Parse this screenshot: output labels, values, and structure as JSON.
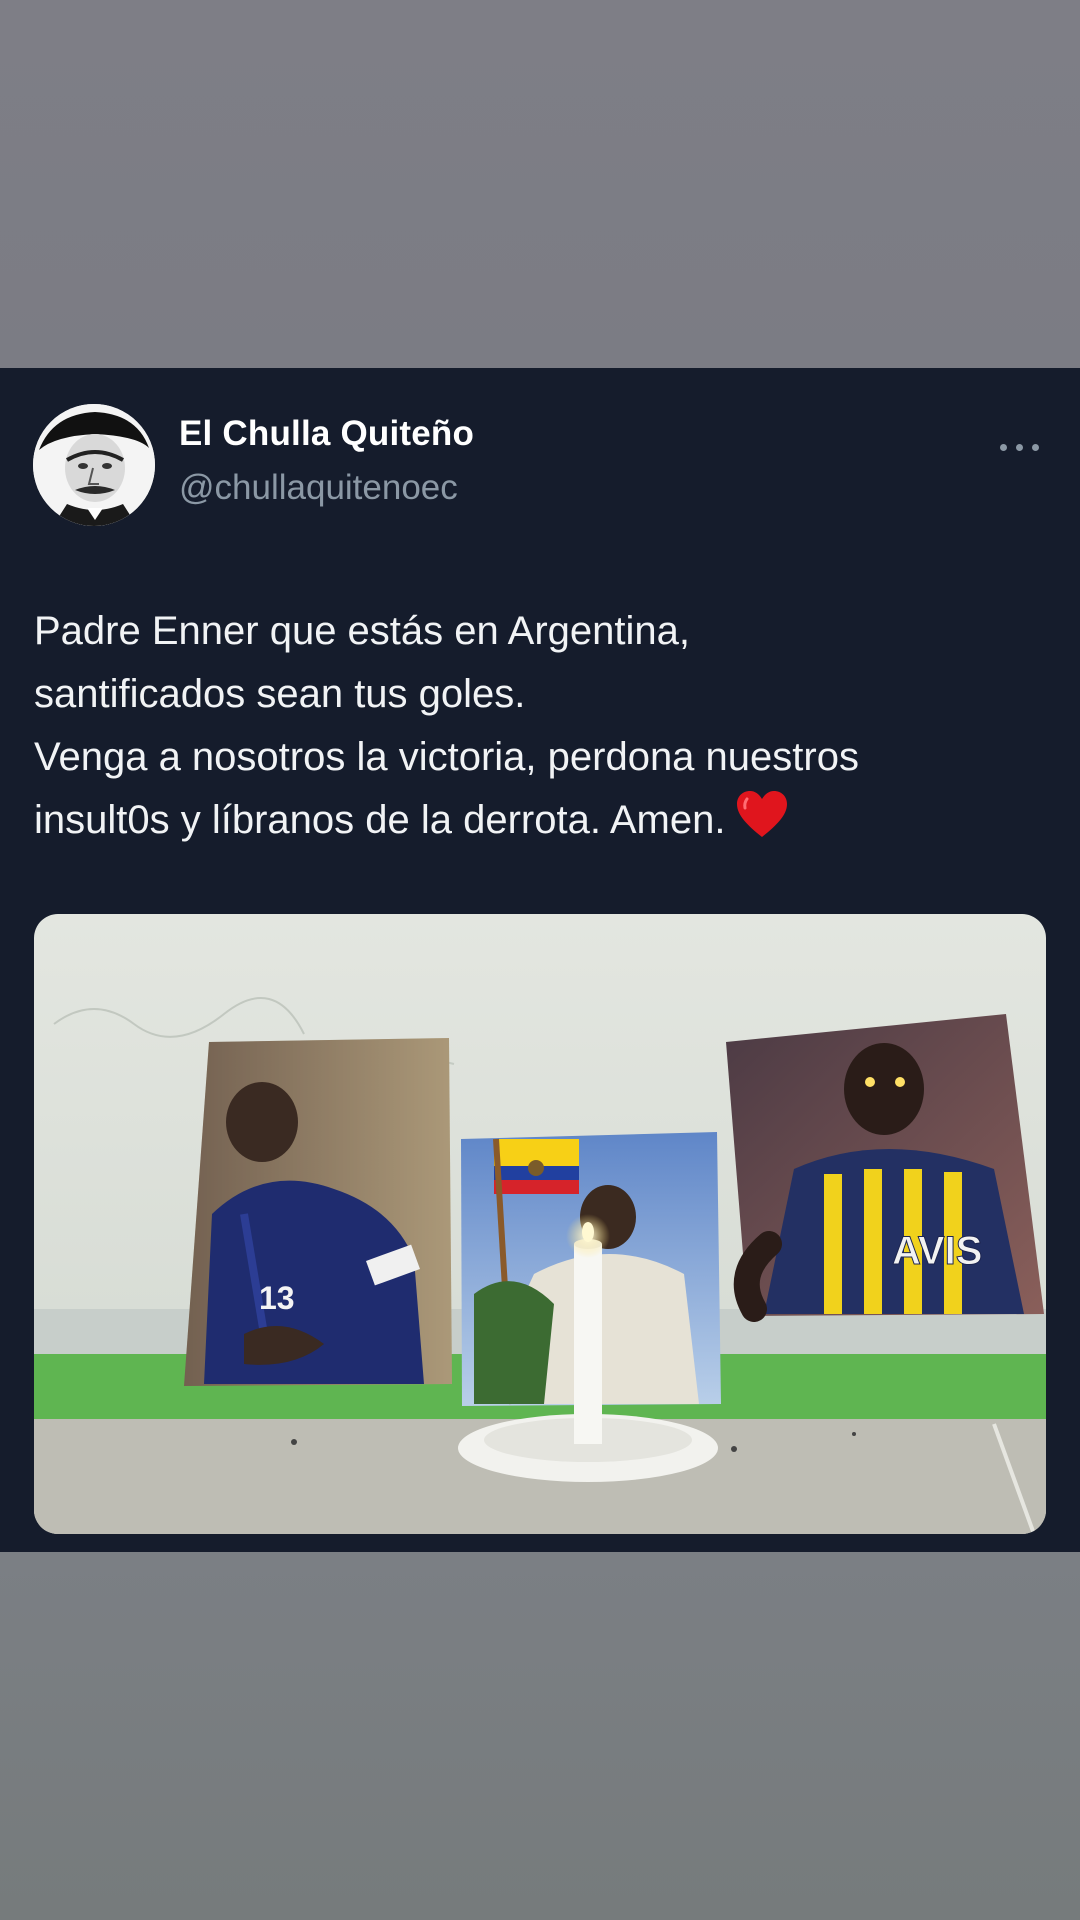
{
  "tweet": {
    "author": {
      "display_name": "El Chulla Quiteño",
      "handle": "@chullaquitenoec",
      "avatar_icon": "avatar-portrait"
    },
    "more_icon": "more-options-icon",
    "text_lines": [
      "Padre Enner que estás en Argentina,",
      "santificados sean tus goles.",
      "Venga a nosotros la victoria, perdona nuestros",
      "insult0s y líbranos de la derrota. Amen."
    ],
    "emoji": "heart-icon",
    "media": {
      "kind": "photo",
      "shirt_number": "13",
      "sponsor_text": "AVIS"
    }
  },
  "colors": {
    "card_background": "#151c2c",
    "name_color": "#ffffff",
    "handle_color": "#8b98a5",
    "text_color": "#f1f3f5",
    "heart_color": "#e0151d",
    "page_background": "#7b7c82"
  }
}
